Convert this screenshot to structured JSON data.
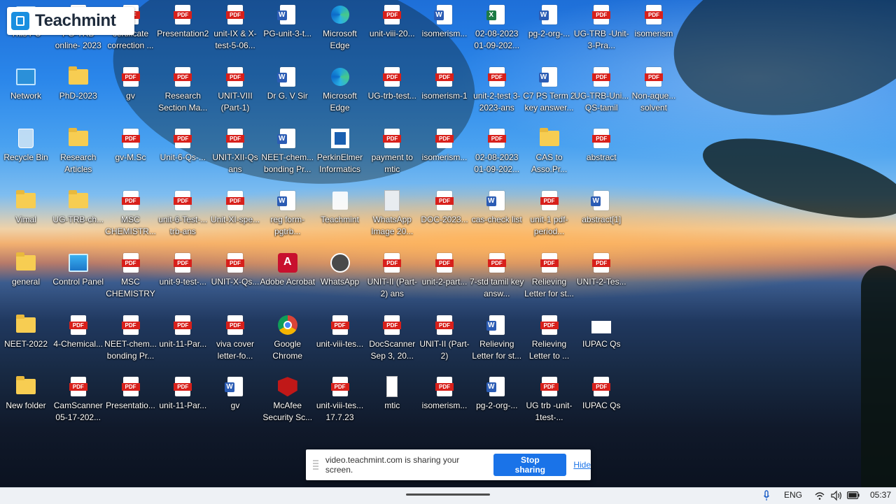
{
  "overlay": {
    "logo_text": "Teachmint"
  },
  "desktop_icons": [
    {
      "label": "This PC",
      "type": "thispc"
    },
    {
      "label": "PG-TRB online- 2023",
      "type": "pdf"
    },
    {
      "label": "certificate correction ...",
      "type": "pdf"
    },
    {
      "label": "Presentation2",
      "type": "pdf"
    },
    {
      "label": "unit-IX & X-test-5-06...",
      "type": "pdf"
    },
    {
      "label": "PG-unit-3-t...",
      "type": "word"
    },
    {
      "label": "Microsoft Edge",
      "type": "edge"
    },
    {
      "label": "unit-viii-20...",
      "type": "pdf"
    },
    {
      "label": "isomerism...",
      "type": "word"
    },
    {
      "label": "02-08-2023 01-09-202...",
      "type": "excel"
    },
    {
      "label": "pg-2-org-...",
      "type": "word"
    },
    {
      "label": "UG-TRB -Unit-3-Pra...",
      "type": "pdf"
    },
    {
      "label": "isomerism",
      "type": "pdf"
    },
    {
      "label": "Network",
      "type": "network"
    },
    {
      "label": "PhD-2023",
      "type": "folder"
    },
    {
      "label": "gv",
      "type": "pdf"
    },
    {
      "label": "Research Section Ma...",
      "type": "pdf"
    },
    {
      "label": "UNIT-VIII (Part-1)",
      "type": "pdf"
    },
    {
      "label": "Dr G. V Sir",
      "type": "word"
    },
    {
      "label": "Microsoft Edge",
      "type": "edge"
    },
    {
      "label": "UG-trb-test...",
      "type": "pdf"
    },
    {
      "label": "isomerism-1",
      "type": "pdf"
    },
    {
      "label": "unit-2-test 3-2023-ans",
      "type": "pdf"
    },
    {
      "label": "C7 PS Term 2 key answer...",
      "type": "word"
    },
    {
      "label": "UG-TRB-Uni... QS-tamil",
      "type": "pdf"
    },
    {
      "label": "Non-aque... solvent",
      "type": "pdf"
    },
    {
      "label": "Recycle Bin",
      "type": "recycle"
    },
    {
      "label": "Research Articles",
      "type": "folder"
    },
    {
      "label": "gv-M.Sc",
      "type": "pdf"
    },
    {
      "label": "Unit-6-Qs-...",
      "type": "pdf"
    },
    {
      "label": "UNIT-XII-Qs ans",
      "type": "pdf"
    },
    {
      "label": "NEET-chem... bonding Pr...",
      "type": "word"
    },
    {
      "label": "PerkinElmer Informatics",
      "type": "perkin"
    },
    {
      "label": "payment to mtic",
      "type": "pdf"
    },
    {
      "label": "isomerism...",
      "type": "pdf"
    },
    {
      "label": "02-08-2023 01-09-202...",
      "type": "pdf"
    },
    {
      "label": "CAS to Asso.Pr...",
      "type": "folder"
    },
    {
      "label": "abstract",
      "type": "pdf"
    },
    {
      "label": "Vimal",
      "type": "folder"
    },
    {
      "label": "UG-TRB-ch...",
      "type": "folder"
    },
    {
      "label": "MSC CHEMISTR...",
      "type": "pdf"
    },
    {
      "label": "unit-6-Test-... trb-ans",
      "type": "pdf"
    },
    {
      "label": "Unit-XI-spe...",
      "type": "pdf"
    },
    {
      "label": "reg form-pgtrb...",
      "type": "word"
    },
    {
      "label": "Teachmint",
      "type": "teach"
    },
    {
      "label": "WhatsApp Image 20...",
      "type": "image"
    },
    {
      "label": "DOC-2023...",
      "type": "pdf"
    },
    {
      "label": "cas-check list",
      "type": "word"
    },
    {
      "label": "unit-1 pdf-period...",
      "type": "pdf"
    },
    {
      "label": "abstract[1]",
      "type": "word"
    },
    {
      "label": "general",
      "type": "folder"
    },
    {
      "label": "Control Panel",
      "type": "control"
    },
    {
      "label": "MSC CHEMISTRY",
      "type": "pdf"
    },
    {
      "label": "unit-9-test-...",
      "type": "pdf"
    },
    {
      "label": "UNIT-X-Qs...",
      "type": "pdf"
    },
    {
      "label": "Adobe Acrobat",
      "type": "acrobat"
    },
    {
      "label": "WhatsApp",
      "type": "whatsapp"
    },
    {
      "label": "UNIT-II (Part-2) ans",
      "type": "pdf"
    },
    {
      "label": "unit-2-part...",
      "type": "pdf"
    },
    {
      "label": "7-std tamil key answ...",
      "type": "pdf"
    },
    {
      "label": "Relieving Letter for st...",
      "type": "pdf"
    },
    {
      "label": "UNIT-2-Tes...",
      "type": "pdf"
    },
    {
      "label": "NEET-2022",
      "type": "folder"
    },
    {
      "label": "4-Chemical...",
      "type": "pdf"
    },
    {
      "label": "NEET-chem... bonding Pr...",
      "type": "pdf"
    },
    {
      "label": "unit-11-Par...",
      "type": "pdf"
    },
    {
      "label": "viva cover letter-fo...",
      "type": "pdf"
    },
    {
      "label": "Google Chrome",
      "type": "chrome"
    },
    {
      "label": "unit-viii-tes...",
      "type": "pdf"
    },
    {
      "label": "DocScanner Sep 3, 20...",
      "type": "pdf"
    },
    {
      "label": "UNIT-II (Part-2)",
      "type": "pdf"
    },
    {
      "label": "Relieving Letter for st...",
      "type": "word"
    },
    {
      "label": "Relieving Letter to ...",
      "type": "pdf"
    },
    {
      "label": "IUPAC Qs",
      "type": "blank"
    },
    {
      "label": "New folder",
      "type": "folder"
    },
    {
      "label": "CamScanner 05-17-202...",
      "type": "pdf"
    },
    {
      "label": "Presentatio...",
      "type": "pdf"
    },
    {
      "label": "unit-11-Par...",
      "type": "pdf"
    },
    {
      "label": "gv",
      "type": "word"
    },
    {
      "label": "McAfee Security Sc...",
      "type": "mcafee"
    },
    {
      "label": "unit-viii-tes... 17.7.23",
      "type": "pdf"
    },
    {
      "label": "mtic",
      "type": "mtic"
    },
    {
      "label": "isomerism...",
      "type": "pdf"
    },
    {
      "label": "pg-2-org-...",
      "type": "word"
    },
    {
      "label": "UG trb -unit-1test-...",
      "type": "pdf"
    },
    {
      "label": "IUPAC Qs",
      "type": "pdf"
    }
  ],
  "share_bar": {
    "message": "video.teachmint.com is sharing your screen.",
    "stop_label": "Stop sharing",
    "hide_label": "Hide",
    "button_color": "#1a73e8"
  },
  "taskbar": {
    "language": "ENG",
    "time": "05:37",
    "tray_icons": [
      "microphone-icon",
      "wifi-icon",
      "volume-icon",
      "battery-icon"
    ]
  }
}
